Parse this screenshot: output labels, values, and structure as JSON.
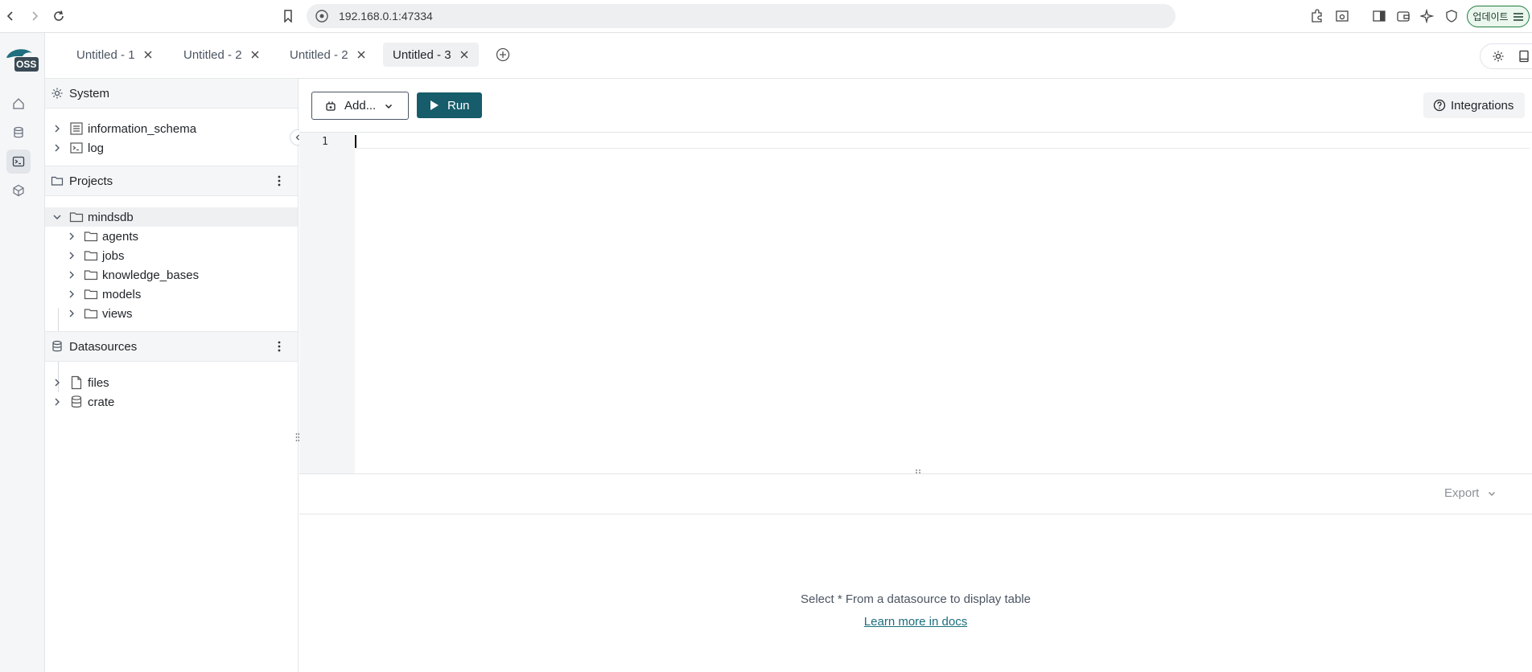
{
  "browser": {
    "url": "192.168.0.1:47334",
    "update_label": "업데이트"
  },
  "app": {
    "logo_text": "OSS"
  },
  "tabs": [
    {
      "label": "Untitled - 1"
    },
    {
      "label": "Untitled - 2"
    },
    {
      "label": "Untitled - 2"
    },
    {
      "label": "Untitled - 3"
    }
  ],
  "sidebar": {
    "system": {
      "title": "System",
      "items": [
        {
          "label": "information_schema"
        },
        {
          "label": "log"
        }
      ]
    },
    "projects": {
      "title": "Projects",
      "root": "mindsdb",
      "children": [
        {
          "label": "agents"
        },
        {
          "label": "jobs"
        },
        {
          "label": "knowledge_bases"
        },
        {
          "label": "models"
        },
        {
          "label": "views"
        }
      ]
    },
    "datasources": {
      "title": "Datasources",
      "items": [
        {
          "label": "files"
        },
        {
          "label": "crate"
        }
      ]
    }
  },
  "toolbar": {
    "add_label": "Add...",
    "run_label": "Run",
    "integrations_label": "Integrations"
  },
  "editor": {
    "line_number": "1"
  },
  "results": {
    "export_label": "Export",
    "empty_message": "Select * From a datasource to display table",
    "docs_link": "Learn more in docs"
  },
  "colors": {
    "accent": "#175c6a",
    "link": "#1a6e7c"
  }
}
